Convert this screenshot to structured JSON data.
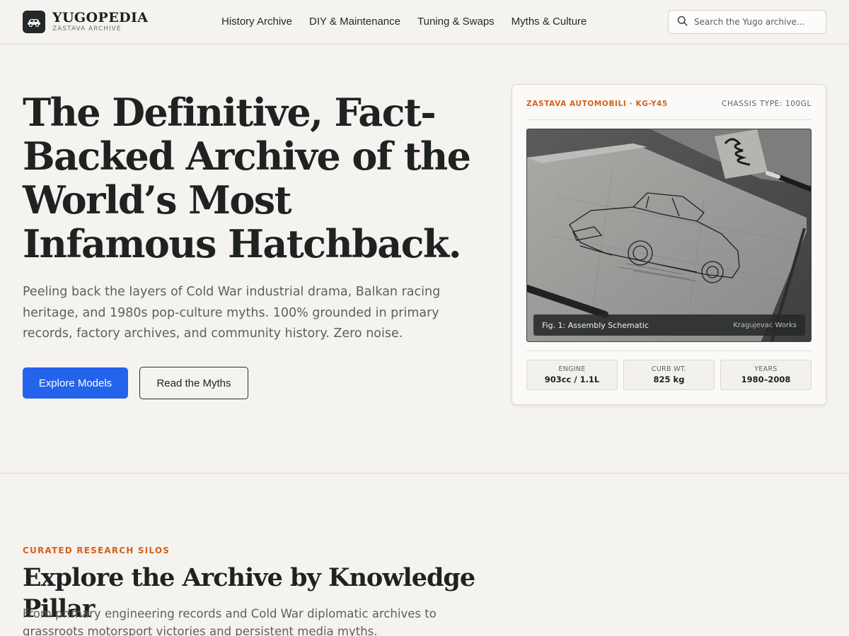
{
  "header": {
    "brand_name": "YUGOPEDIA",
    "brand_sub": "ZASTAVA ARCHIVE",
    "logo_icon": "car-icon",
    "nav": [
      {
        "label": "History Archive"
      },
      {
        "label": "DIY & Maintenance"
      },
      {
        "label": "Tuning & Swaps"
      },
      {
        "label": "Myths & Culture"
      }
    ],
    "search_placeholder": "Search the Yugo archive...",
    "search_icon": "search-icon"
  },
  "hero": {
    "title": "The Definitive, Fact-Backed Archive of the World’s Most Infamous Hatchback.",
    "description": "Peeling back the layers of Cold War industrial drama, Balkan racing heritage, and 1980s pop-culture myths. 100% grounded in primary records, factory archives, and community history. Zero noise.",
    "primary_button": "Explore Models",
    "secondary_button": "Read the Myths"
  },
  "card": {
    "maker": "ZASTAVA AUTOMOBILI · KG-Y45",
    "chassis": "CHASSIS TYPE: 100GL",
    "caption_left": "Fig. 1: Assembly Schematic",
    "caption_right": "Kragujevac Works",
    "specs": [
      {
        "label": "ENGINE",
        "value": "903cc / 1.1L"
      },
      {
        "label": "CURB WT.",
        "value": "825 kg"
      },
      {
        "label": "YEARS",
        "value": "1980–2008"
      }
    ]
  },
  "section": {
    "eyebrow": "CURATED RESEARCH SILOS",
    "title": "Explore the Archive by Knowledge Pillar",
    "description": "From primary engineering records and Cold War diplomatic archives to grassroots motorsport victories and persistent media myths."
  },
  "colors": {
    "accent": "#d5601b",
    "primary_button": "#2463eb",
    "background": "#f5f3ef"
  }
}
